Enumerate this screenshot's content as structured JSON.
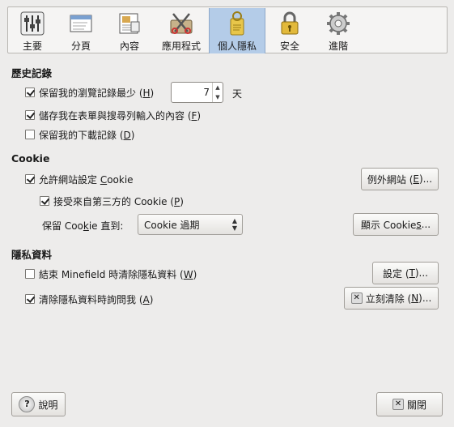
{
  "toolbar": {
    "items": [
      {
        "label": "主要",
        "icon": "sliders-icon"
      },
      {
        "label": "分頁",
        "icon": "tabs-icon"
      },
      {
        "label": "內容",
        "icon": "content-icon"
      },
      {
        "label": "應用程式",
        "icon": "applications-icon"
      },
      {
        "label": "個人隱私",
        "icon": "door-hanger-icon",
        "active": true
      },
      {
        "label": "安全",
        "icon": "lock-icon"
      },
      {
        "label": "進階",
        "icon": "gear-icon"
      }
    ]
  },
  "history": {
    "heading": "歷史記錄",
    "keep_history": {
      "label_pre": "保留我的瀏覽記錄最少 (",
      "key": "H",
      "label_post": ")",
      "checked": true
    },
    "days_value": "7",
    "days_unit": "天",
    "remember_forms": {
      "label_pre": "儲存我在表單與搜尋列輸入的內容 (",
      "key": "F",
      "label_post": ")",
      "checked": true
    },
    "remember_downloads": {
      "label_pre": "保留我的下載記錄 (",
      "key": "D",
      "label_post": ")",
      "checked": false
    }
  },
  "cookie": {
    "heading": "Cookie",
    "accept": {
      "label_pre": "允許網站設定 ",
      "key": "C",
      "label_post": "ookie",
      "checked": true
    },
    "third_party": {
      "label_pre": "接受來自第三方的 Cookie (",
      "key": "P",
      "label_post": ")",
      "checked": true
    },
    "keep_until_pre": "保留 Coo",
    "keep_until_key": "k",
    "keep_until_post": "ie 直到:",
    "keep_until_value": "Cookie 過期",
    "exceptions_button": {
      "pre": "例外網站 (",
      "key": "E",
      "post": ")..."
    },
    "show_cookies_button": {
      "pre": "顯示 Cookie",
      "key": "s",
      "post": "..."
    }
  },
  "private_data": {
    "heading": "隱私資料",
    "clear_on_close": {
      "label_pre": "結束 Minefield 時清除隱私資料 (",
      "key": "W",
      "label_post": ")",
      "checked": false
    },
    "ask_before_clear": {
      "label_pre": "清除隱私資料時詢問我 (",
      "key": "A",
      "label_post": ")",
      "checked": true
    },
    "settings_button": {
      "pre": "設定 (",
      "key": "T",
      "post": ")..."
    },
    "clear_now_button": {
      "pre": "立刻清除 (",
      "key": "N",
      "post": ")..."
    }
  },
  "footer": {
    "help_button": "說明",
    "close_button": "關閉"
  }
}
